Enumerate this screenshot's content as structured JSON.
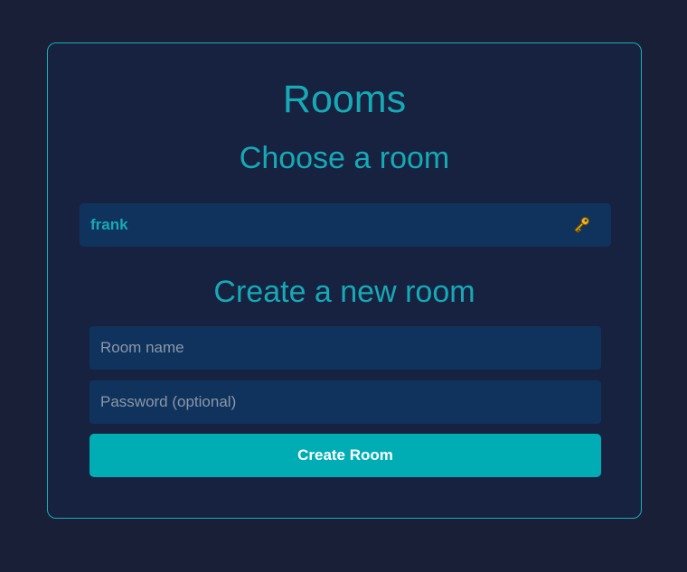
{
  "rooms_panel": {
    "title": "Rooms",
    "choose_heading": "Choose a room",
    "rooms": [
      {
        "name": "frank",
        "icon": "key-icon",
        "protected": true
      }
    ],
    "create_heading": "Create a new room",
    "room_name_input": {
      "value": "",
      "placeholder": "Room name"
    },
    "password_input": {
      "value": "",
      "placeholder": "Password (optional)"
    },
    "create_button_label": "Create Room"
  },
  "colors": {
    "background": "#1a1f38",
    "panel": "#172241",
    "accent": "#17a9b5",
    "field": "#10335e",
    "button": "#00adb5",
    "key_icon": "#f2b21b"
  }
}
